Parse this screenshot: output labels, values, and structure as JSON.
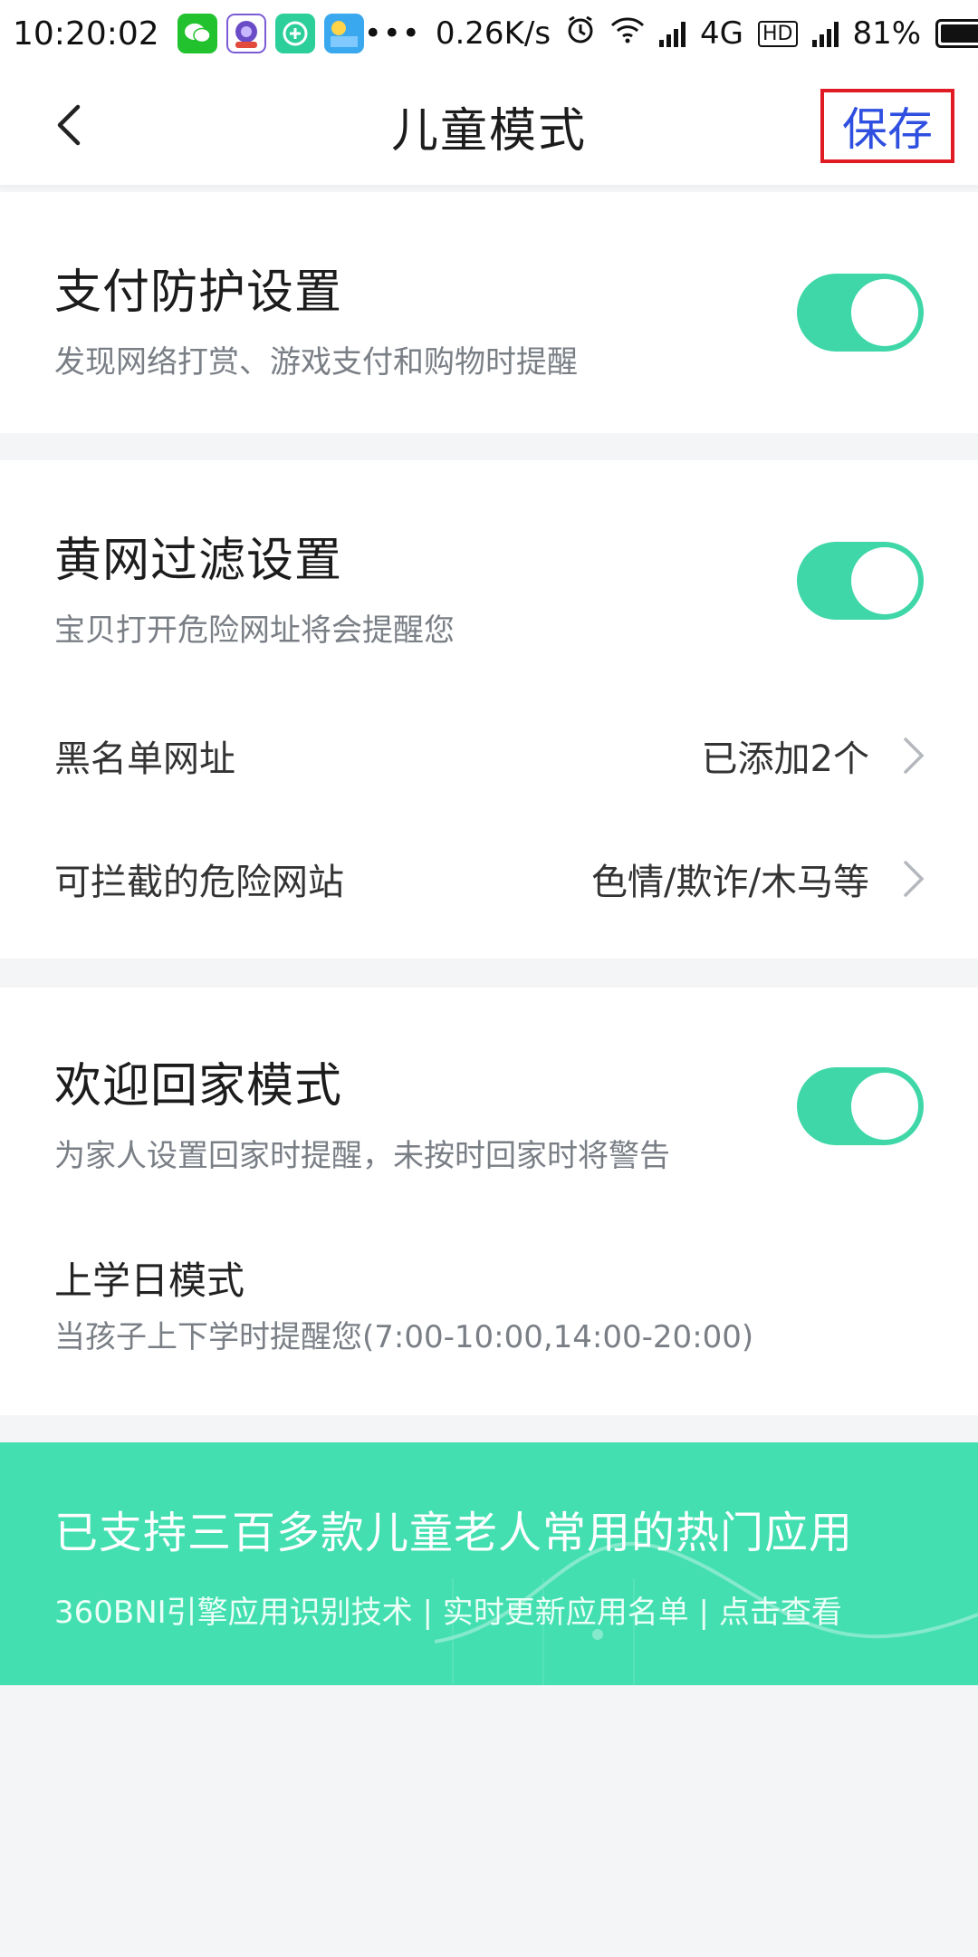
{
  "status_bar": {
    "time": "10:20:02",
    "net_speed": "0.26K/s",
    "network": "4G",
    "hd": "HD",
    "battery": "81%",
    "battery_level": 0.81,
    "icons": [
      "wechat-icon",
      "app-icon",
      "plus-app-icon",
      "weather-icon",
      "more-dots-icon",
      "alarm-icon",
      "wifi-icon",
      "signal-icon",
      "battery-icon"
    ]
  },
  "nav": {
    "title": "儿童模式",
    "save_label": "保存"
  },
  "payment": {
    "title": "支付防护设置",
    "subtitle": "发现网络打赏、游戏支付和购物时提醒",
    "enabled": true
  },
  "filter": {
    "title": "黄网过滤设置",
    "subtitle": "宝贝打开危险网址将会提醒您",
    "enabled": true,
    "rows": [
      {
        "label": "黑名单网址",
        "value": "已添加2个"
      },
      {
        "label": "可拦截的危险网站",
        "value": "色情/欺诈/木马等"
      }
    ]
  },
  "home": {
    "title": "欢迎回家模式",
    "subtitle": "为家人设置回家时提醒，未按时回家时将警告",
    "enabled": true,
    "school": {
      "title": "上学日模式",
      "subtitle": "当孩子上下学时提醒您(7:00-10:00,14:00-20:00)"
    }
  },
  "banner": {
    "title": "已支持三百多款儿童老人常用的热门应用",
    "subtitle": "360BNI引擎应用识别技术 | 实时更新应用名单 | 点击查看"
  },
  "colors": {
    "accent": "#3fd7a7",
    "save_text": "#2f4fe0",
    "highlight_border": "#e01b24",
    "banner": "#43dfb0"
  }
}
